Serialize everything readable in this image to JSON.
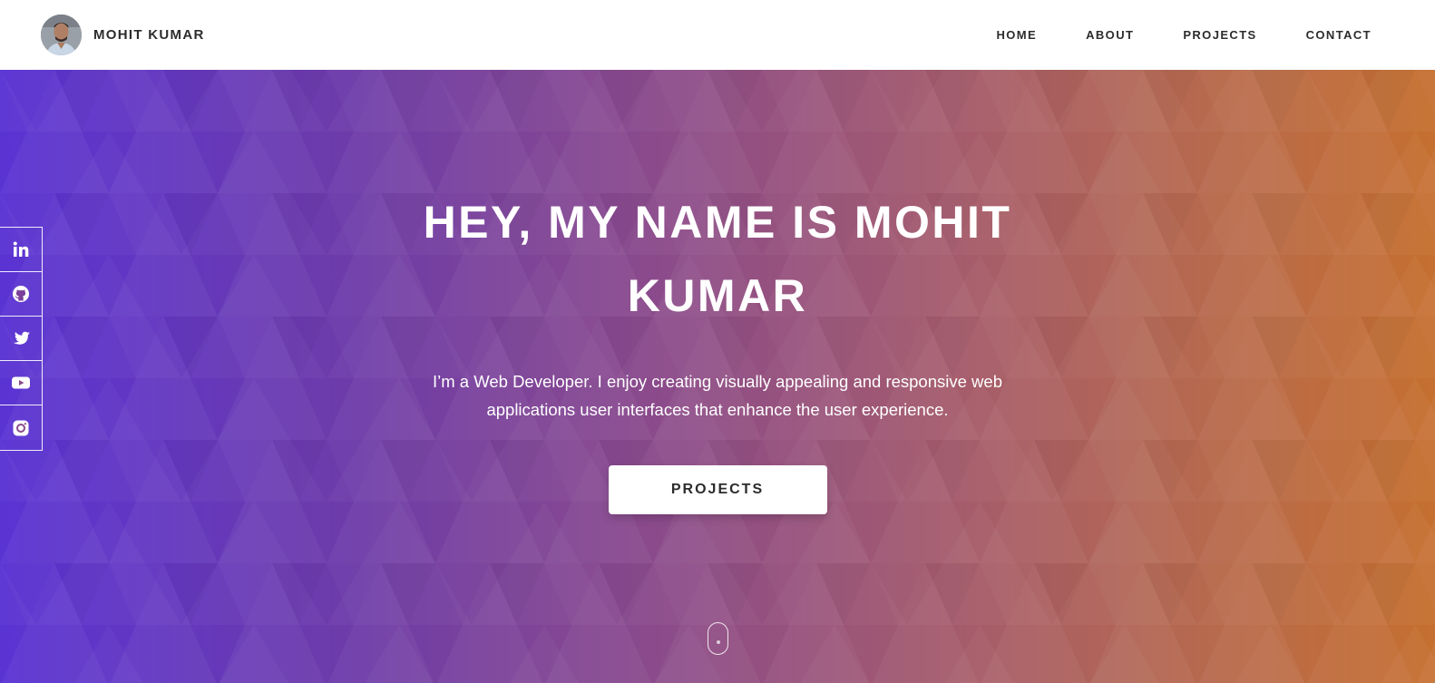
{
  "header": {
    "brand_name": "MOHIT KUMAR",
    "nav": [
      {
        "label": "HOME"
      },
      {
        "label": "ABOUT"
      },
      {
        "label": "PROJECTS"
      },
      {
        "label": "CONTACT"
      }
    ]
  },
  "hero": {
    "title": "HEY, MY NAME IS MOHIT KUMAR",
    "description": "I’m a Web Developer. I enjoy creating visually appealing and responsive web applications user interfaces that enhance the user experience.",
    "cta_label": "PROJECTS"
  },
  "social": [
    {
      "icon": "linkedin-icon"
    },
    {
      "icon": "github-icon"
    },
    {
      "icon": "twitter-icon"
    },
    {
      "icon": "youtube-icon"
    },
    {
      "icon": "instagram-icon"
    }
  ],
  "colors": {
    "gradient_start": "#5a33d3",
    "gradient_end": "#c56f30",
    "header_bg": "#ffffff",
    "text_dark": "#2c2c2c"
  }
}
